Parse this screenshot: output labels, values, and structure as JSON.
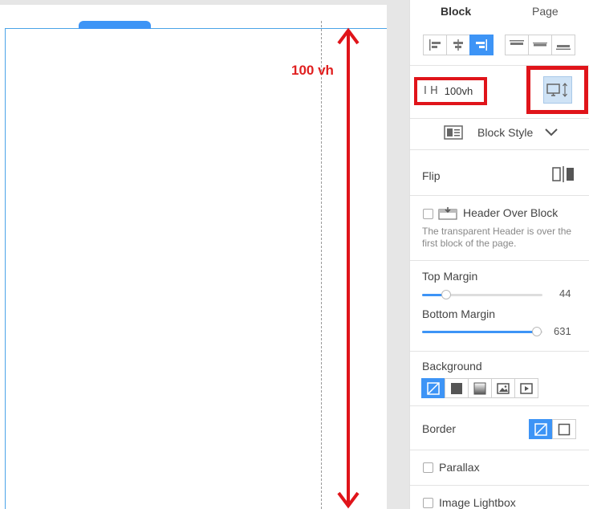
{
  "canvas": {
    "height_annotation": "100 vh"
  },
  "panel": {
    "tabs": [
      {
        "label": "Block",
        "active": true
      },
      {
        "label": "Page",
        "active": false
      }
    ],
    "height": {
      "icon": "height-icon",
      "value": "100vh"
    },
    "block_style": {
      "label": "Block Style"
    },
    "flip": {
      "label": "Flip"
    },
    "header_over_block": {
      "label": "Header Over Block",
      "description": "The transparent Header is over the first block of the page.",
      "checked": false
    },
    "top_margin": {
      "label": "Top Margin",
      "value": "44",
      "fraction": 0.2
    },
    "bottom_margin": {
      "label": "Bottom Margin",
      "value": "631",
      "fraction": 1.0
    },
    "background": {
      "label": "Background",
      "options": [
        "none-icon",
        "solid-color-icon",
        "gradient-icon",
        "image-icon",
        "video-icon"
      ],
      "selected": "none-icon"
    },
    "border": {
      "label": "Border",
      "options": [
        "none-icon",
        "border-square-icon"
      ],
      "selected": "none-icon"
    },
    "parallax": {
      "label": "Parallax",
      "checked": false
    },
    "image_lightbox": {
      "label": "Image Lightbox",
      "checked": false
    }
  },
  "colors": {
    "accent": "#3d94f6",
    "annotation": "#e0141a"
  }
}
